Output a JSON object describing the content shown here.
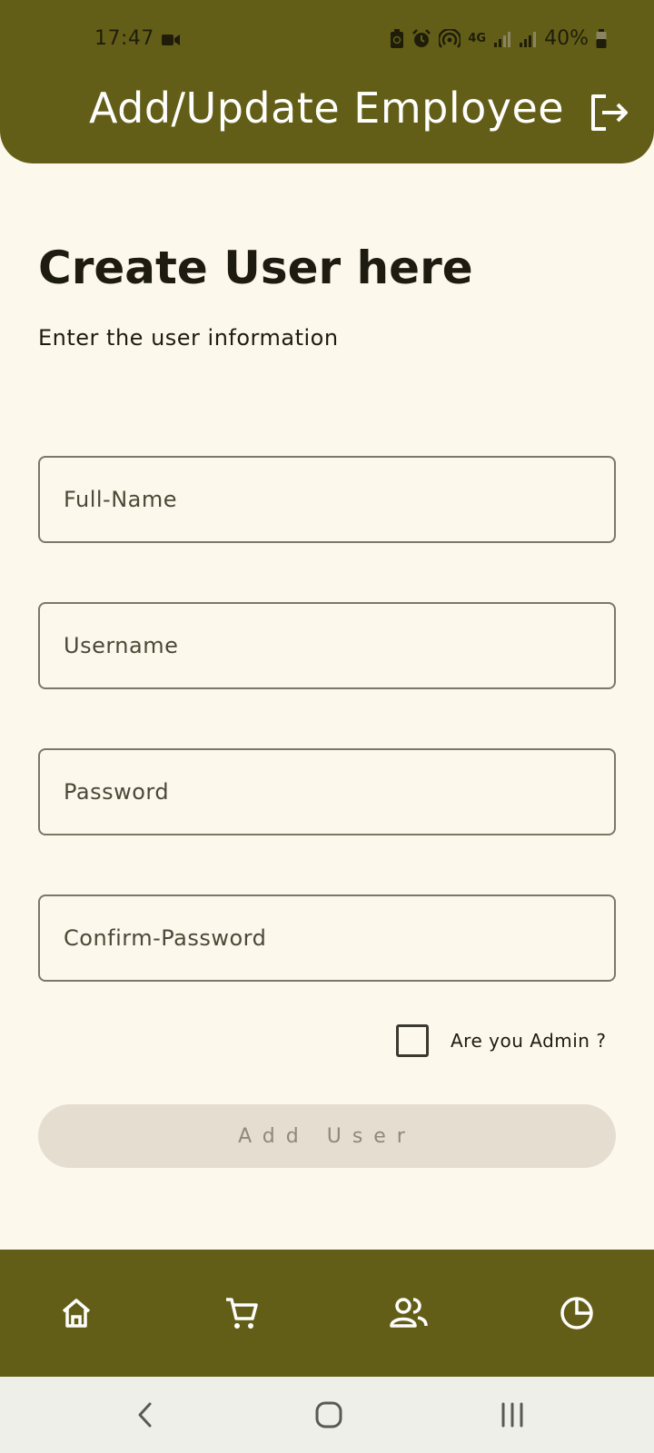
{
  "status_bar": {
    "time": "17:47",
    "battery": "40%",
    "network": "4G"
  },
  "header": {
    "title": "Add/Update Employee",
    "logout_icon": "logout-icon"
  },
  "form": {
    "heading": "Create User here",
    "subheading": "Enter the user information",
    "fields": [
      {
        "placeholder": "Full-Name",
        "value": ""
      },
      {
        "placeholder": "Username",
        "value": ""
      },
      {
        "placeholder": "Password",
        "value": ""
      },
      {
        "placeholder": "Confirm-Password",
        "value": ""
      }
    ],
    "admin_label": "Are you Admin ?",
    "admin_checked": false,
    "submit_label": "Add User"
  },
  "bottom_nav": {
    "items": [
      {
        "icon": "home-icon"
      },
      {
        "icon": "cart-icon"
      },
      {
        "icon": "users-icon"
      },
      {
        "icon": "pie-chart-icon"
      }
    ]
  },
  "system_nav": {
    "items": [
      {
        "icon": "back-icon"
      },
      {
        "icon": "home-circle-icon"
      },
      {
        "icon": "recents-icon"
      }
    ]
  },
  "colors": {
    "primary": "#635e17",
    "background": "#fdf8ec",
    "button_disabled": "#e5ddcf"
  }
}
